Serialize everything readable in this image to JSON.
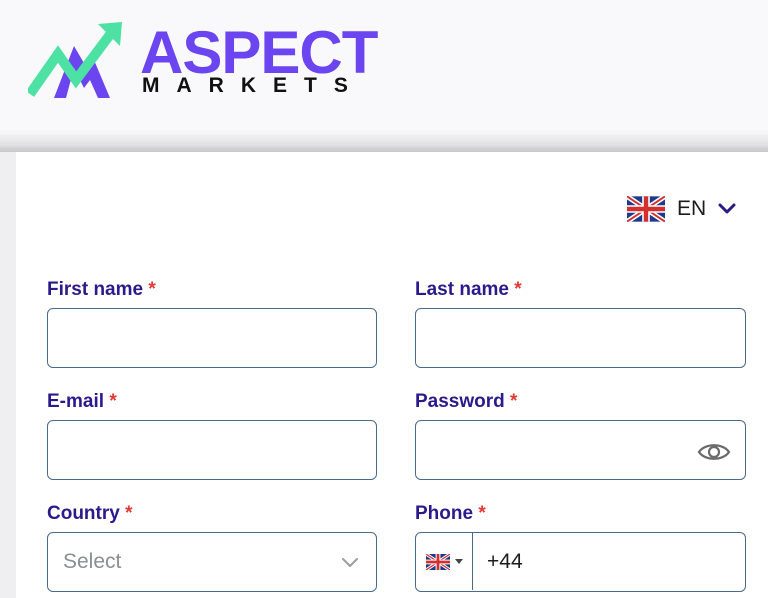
{
  "brand": {
    "name": "ASPECT",
    "sub": "MARKETS",
    "primary_color": "#6a45f0",
    "accent_color": "#4ee1a4"
  },
  "language": {
    "code": "EN",
    "flag_icon": "uk-flag-icon"
  },
  "form": {
    "first_name": {
      "label": "First name",
      "required": "*",
      "value": ""
    },
    "last_name": {
      "label": "Last name",
      "required": "*",
      "value": ""
    },
    "email": {
      "label": "E-mail",
      "required": "*",
      "value": ""
    },
    "password": {
      "label": "Password",
      "required": "*",
      "value": "",
      "icon": "eye-icon"
    },
    "country": {
      "label": "Country",
      "required": "*",
      "placeholder": "Select"
    },
    "phone": {
      "label": "Phone",
      "required": "*",
      "code": "+44",
      "flag_icon": "uk-flag-icon"
    }
  },
  "colors": {
    "label": "#2b1a8c",
    "required": "#e53935",
    "input_border": "#4b6a8a"
  }
}
